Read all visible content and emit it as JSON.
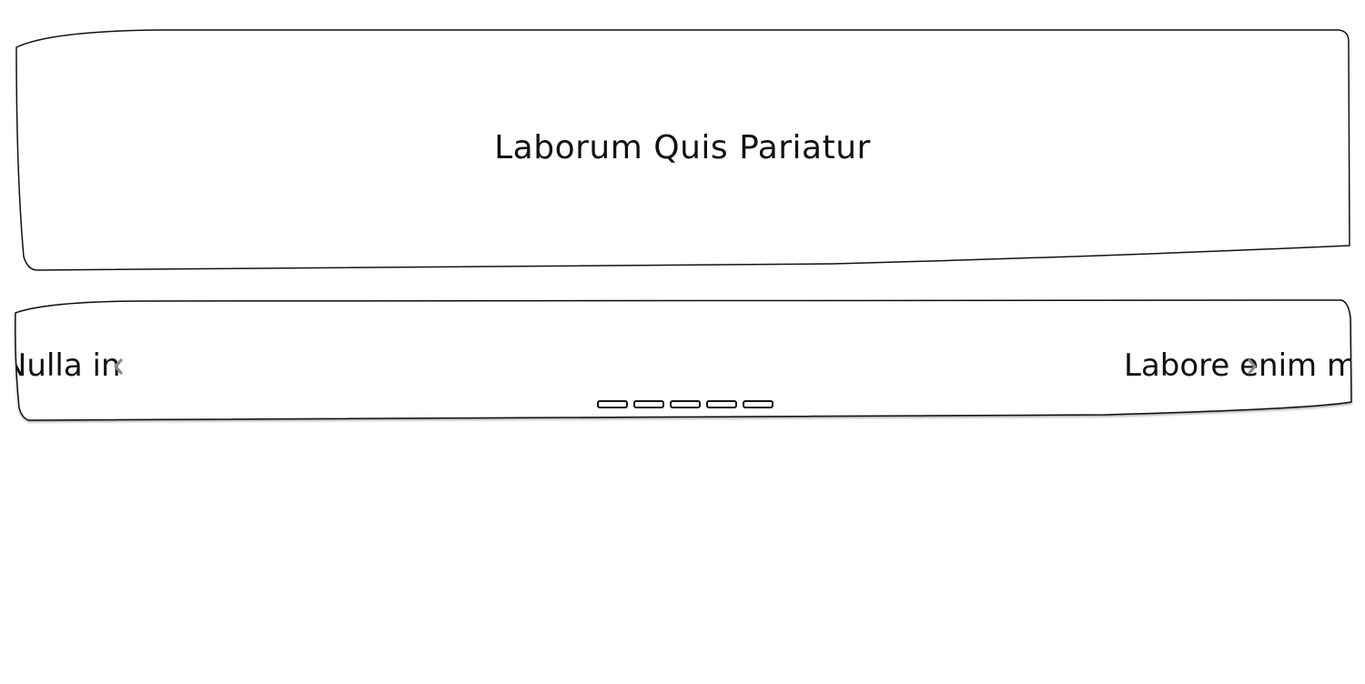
{
  "header": {
    "title": "Laborum Quis Pariatur"
  },
  "carousel": {
    "prev_slide_text": "Nulla in",
    "next_slide_text": "Labore enim mo",
    "prev_icon": "chevron-left-icon",
    "next_icon": "chevron-right-icon",
    "dot_count": 5,
    "colors": {
      "arrow": "#8a8a8a",
      "border": "#111111"
    }
  }
}
